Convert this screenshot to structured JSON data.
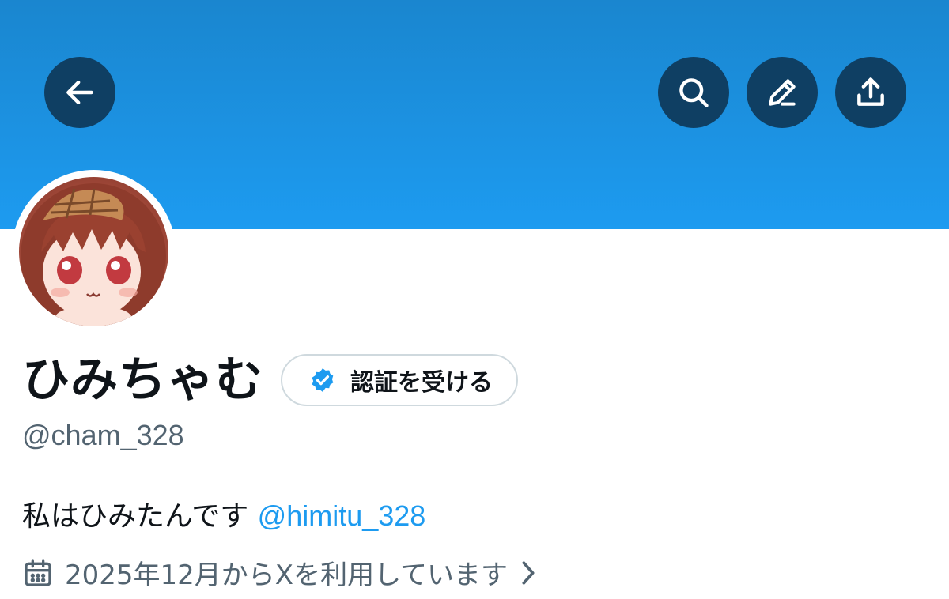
{
  "header": {
    "banner_color": "#1d9bf0",
    "buttons": [
      {
        "name": "back",
        "icon": "arrow-left-icon"
      },
      {
        "name": "search",
        "icon": "search-icon"
      },
      {
        "name": "edit",
        "icon": "pencil-icon"
      },
      {
        "name": "share",
        "icon": "share-upload-icon"
      }
    ]
  },
  "profile": {
    "avatar": "anime-girl-avatar",
    "display_name": "ひみちゃむ",
    "verify_label": "認証を受ける",
    "handle": "@cham_328",
    "bio_text": "私はひみたんです ",
    "bio_mention": "@himitu_328",
    "joined": "2025年12月からXを利用しています"
  },
  "colors": {
    "accent": "#1d9bf0",
    "text_primary": "#0f1419",
    "text_secondary": "#536471",
    "button_dark": "#0f3f63"
  }
}
